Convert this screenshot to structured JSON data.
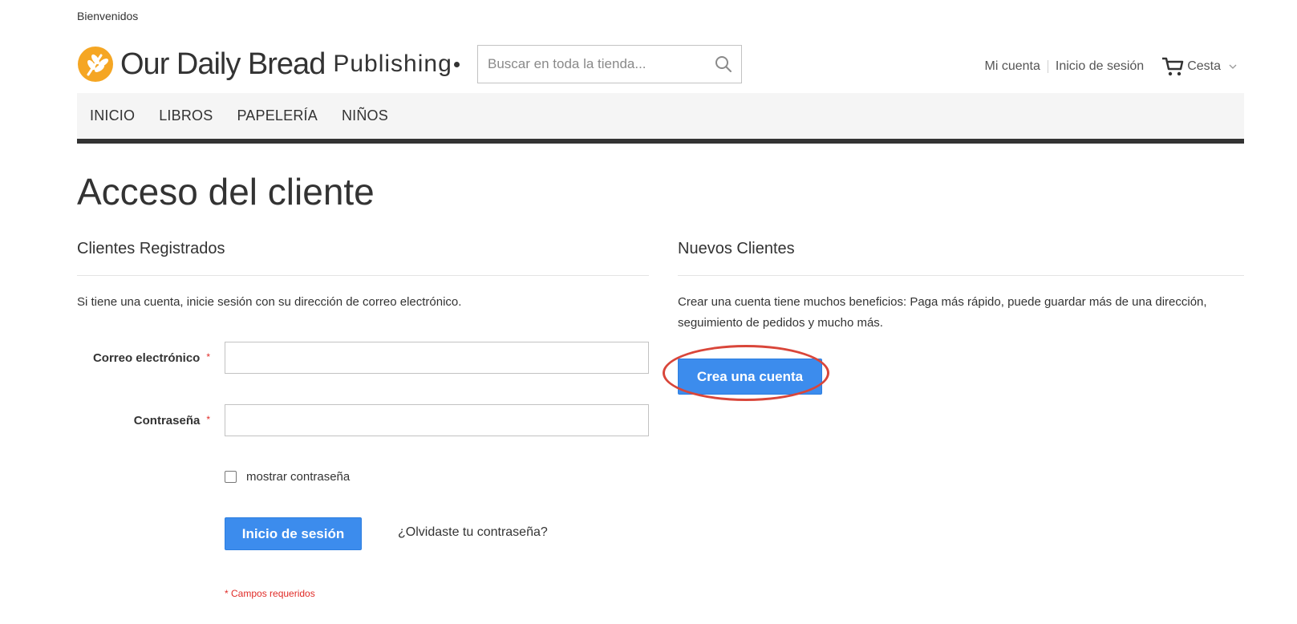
{
  "top": {
    "welcome": "Bienvenidos"
  },
  "brand": {
    "name": "Our Daily Bread",
    "suffix": "Publishing"
  },
  "search": {
    "placeholder": "Buscar en toda la tienda..."
  },
  "header": {
    "account_link": "Mi cuenta",
    "signin_link": "Inicio de sesión",
    "cart_label": "Cesta"
  },
  "nav": {
    "items": [
      {
        "label": "INICIO"
      },
      {
        "label": "LIBROS"
      },
      {
        "label": "PAPELERÍA"
      },
      {
        "label": "NIÑOS"
      }
    ]
  },
  "page": {
    "title": "Acceso del cliente"
  },
  "registered": {
    "title": "Clientes Registrados",
    "intro": "Si tiene una cuenta, inicie sesión con su dirección de correo electrónico.",
    "email_label": "Correo electrónico",
    "email_value": "",
    "password_label": "Contraseña",
    "password_value": "",
    "required_mark": "*",
    "show_password": "mostrar contraseña",
    "show_password_checked": false,
    "signin_button": "Inicio de sesión",
    "forgot_link": "¿Olvidaste tu contraseña?",
    "required_note": "* Campos requeridos"
  },
  "new_customers": {
    "title": "Nuevos Clientes",
    "intro": "Crear una cuenta tiene muchos beneficios: Paga más rápido, puede guardar más de una dirección, seguimiento de pedidos y mucho más.",
    "create_button": "Crea una cuenta"
  },
  "colors": {
    "primary_button": "#3c8ced",
    "required": "#e02b27",
    "logo_orange": "#f5a623",
    "nav_bar": "#f5f5f5",
    "nav_rule": "#333333",
    "highlight": "#d9463a"
  },
  "icons": {
    "logo": "wheat-logo-icon",
    "search": "search-icon",
    "cart": "cart-icon",
    "cart_dropdown": "chevron-down-icon"
  }
}
